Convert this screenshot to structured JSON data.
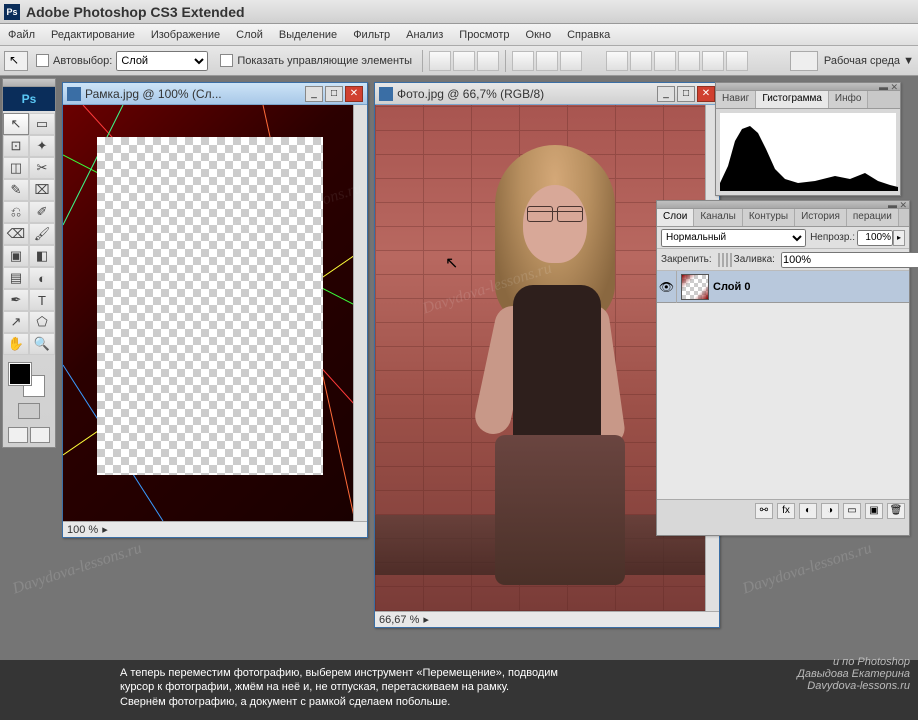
{
  "app": {
    "title": "Adobe Photoshop CS3 Extended",
    "logo_text": "Ps"
  },
  "menu": [
    "Файл",
    "Редактирование",
    "Изображение",
    "Слой",
    "Выделение",
    "Фильтр",
    "Анализ",
    "Просмотр",
    "Окно",
    "Справка"
  ],
  "options": {
    "autoselect_label": "Автовыбор:",
    "autoselect_value": "Слой",
    "show_controls_label": "Показать управляющие элементы",
    "workspace_label": "Рабочая среда ▼"
  },
  "tools": [
    "↖",
    "▭",
    "⊡",
    "✦",
    "◫",
    "✂",
    "✎",
    "⌧",
    "⎌",
    "✐",
    "⌫",
    "🖌",
    "▣",
    "◧",
    "▤",
    "◐",
    "✒",
    "T",
    "↗",
    "⬠",
    "✋",
    "🔍"
  ],
  "win1": {
    "title": "Рамка.jpg @ 100% (Сл...",
    "zoom": "100 %"
  },
  "win2": {
    "title": "Фото.jpg @ 66,7% (RGB/8)",
    "zoom": "66,67 %"
  },
  "panel_hist": {
    "tabs": [
      "Навиг",
      "Гистограмма",
      "Инфо"
    ],
    "active": 1
  },
  "panel_layers": {
    "tabs": [
      "Слои",
      "Каналы",
      "Контуры",
      "История",
      "перации"
    ],
    "active": 0,
    "blend_mode": "Нормальный",
    "opacity_label": "Непрозр.:",
    "opacity_value": "100%",
    "lock_label": "Закрепить:",
    "fill_label": "Заливка:",
    "fill_value": "100%",
    "layers": [
      {
        "name": "Слой 0",
        "visible": true
      }
    ]
  },
  "subtitle": {
    "line1": "А теперь переместим фотографию, выберем инструмент «Перемещение», подводим",
    "line2": "курсор к фотографии, жмём на неё и, не отпуская, перетаскиваем на рамку.",
    "line3": "Свернём фотографию, а документ с рамкой сделаем побольше.",
    "credit1": "и по Photoshop",
    "credit2": "Давыдова Екатерина",
    "credit3": "Davydova-lessons.ru"
  },
  "watermark_text": "Davydova-lessons.ru"
}
